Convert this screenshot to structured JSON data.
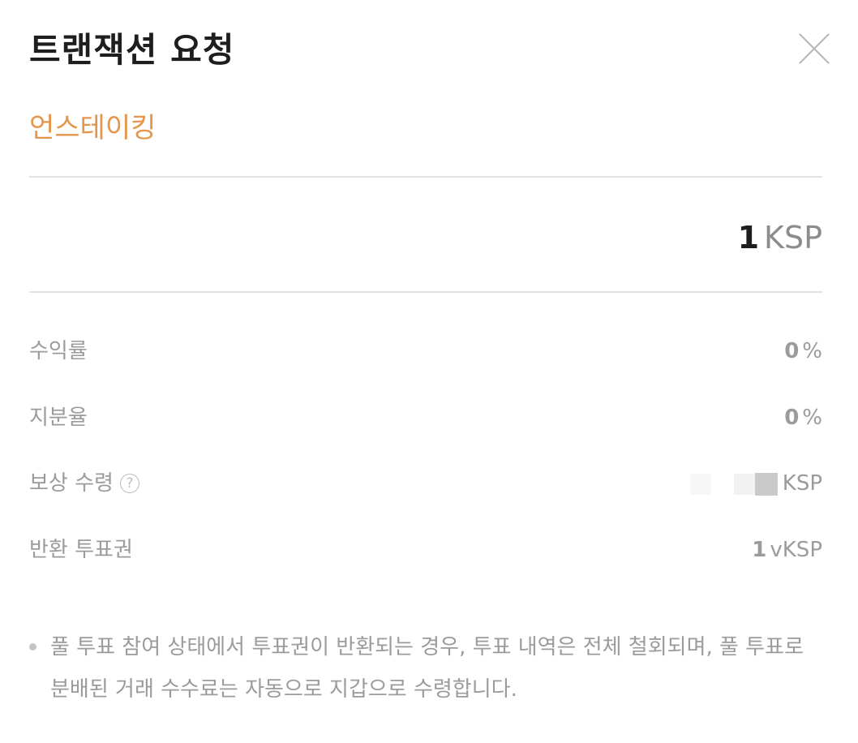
{
  "modal": {
    "title": "트랜잭션 요청",
    "subtitle": "언스테이킹"
  },
  "amount": {
    "value": "1",
    "unit": "KSP"
  },
  "rows": [
    {
      "label": "수익률",
      "value": "0",
      "unit": "%"
    },
    {
      "label": "지분율",
      "value": "0",
      "unit": "%"
    },
    {
      "label": "보상 수령",
      "value_suffix": "KSP",
      "help_icon": "question-circle-icon"
    },
    {
      "label": "반환 투표권",
      "value": "1",
      "unit": "vKSP"
    }
  ],
  "note": "풀 투표 참여 상태에서 투표권이 반환되는 경우, 투표 내역은 전체 철회되며, 풀 투표로 분배된 거래 수수료는 자동으로 지갑으로 수령합니다.",
  "colors": {
    "accent": "#e6964a",
    "title": "#1e1e1e",
    "muted": "#9b9b9b",
    "divider": "#e3e3e3"
  },
  "icons": {
    "close": "close-icon",
    "help": "question-circle-icon"
  }
}
